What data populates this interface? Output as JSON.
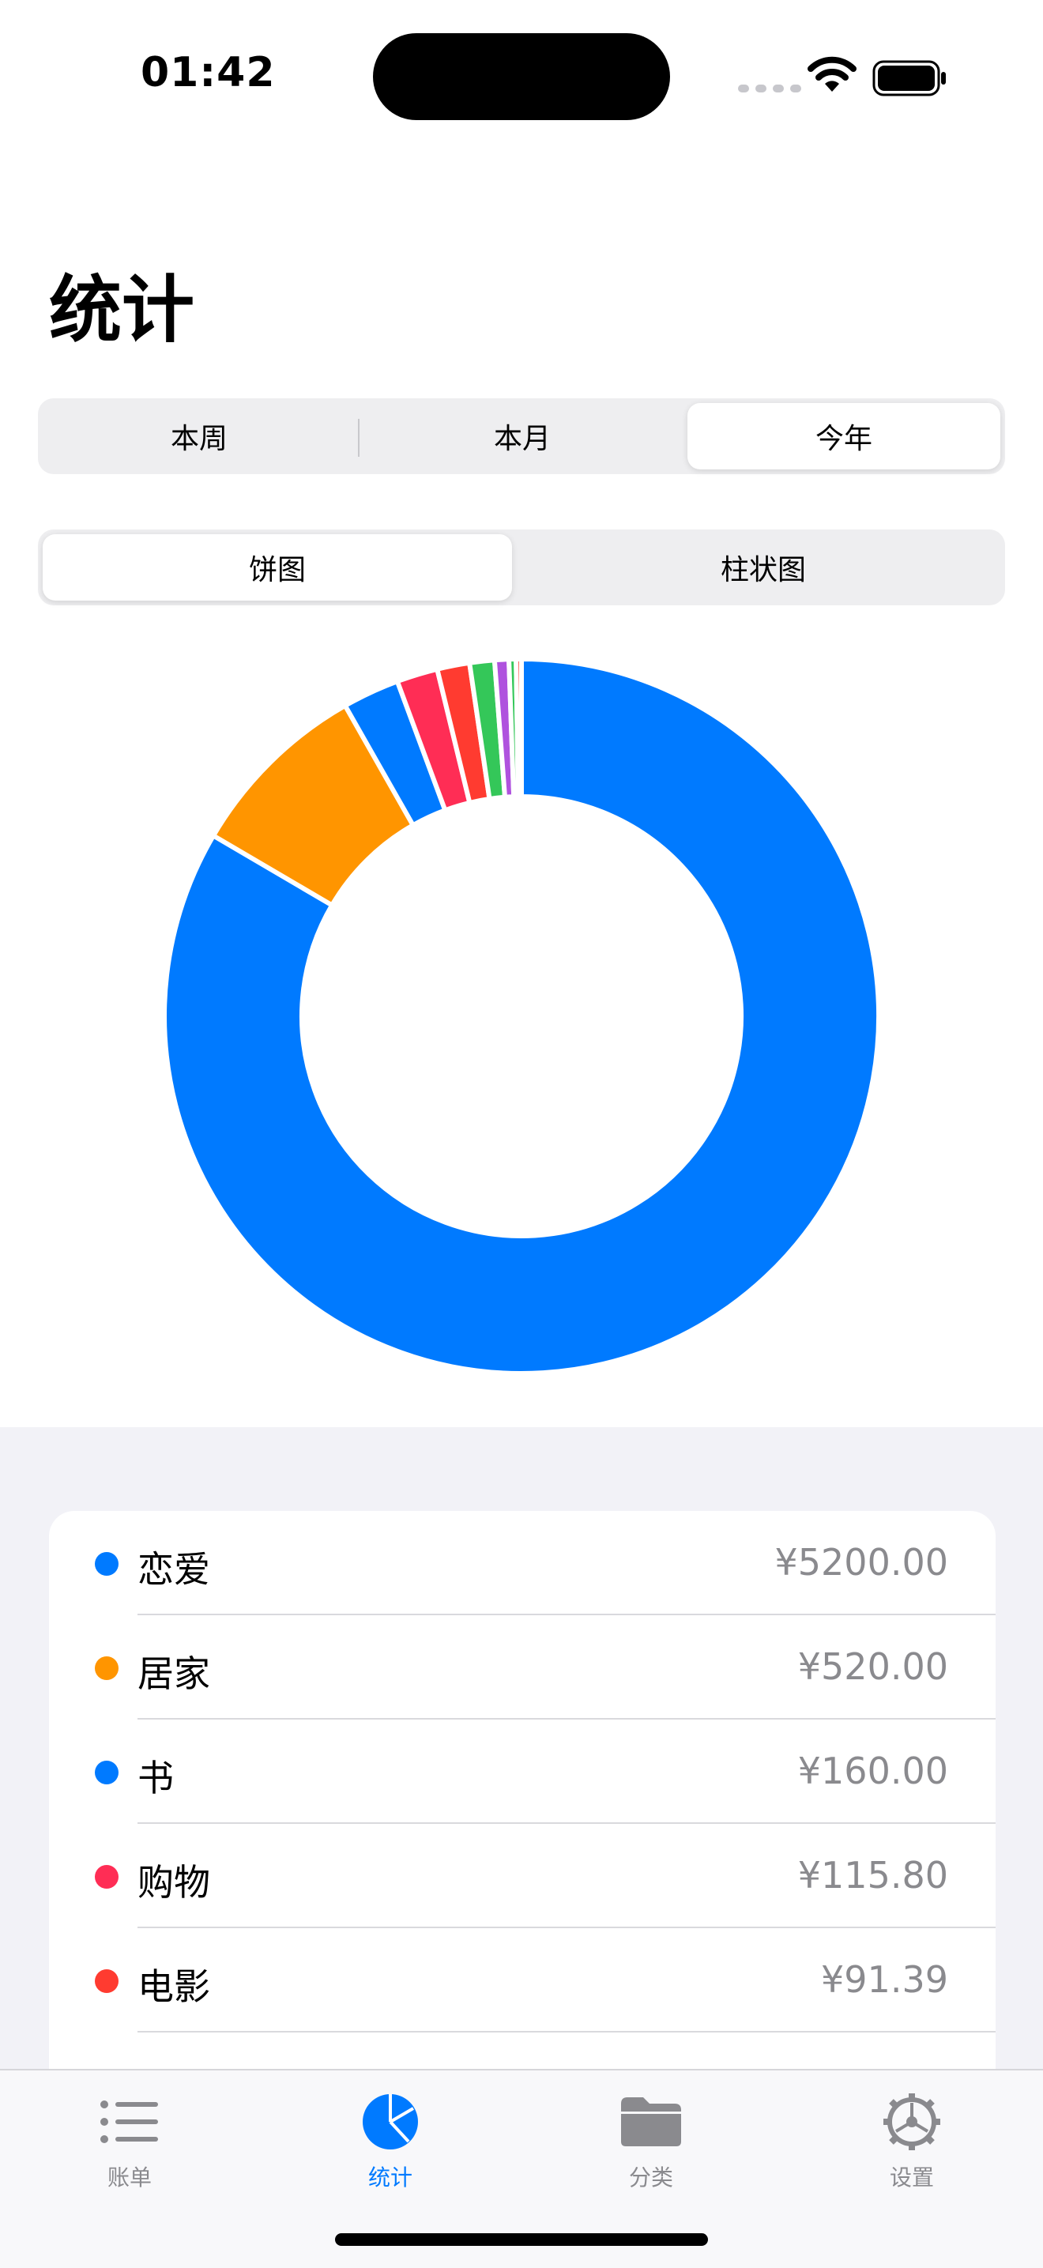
{
  "status_bar": {
    "time": "01:42"
  },
  "page": {
    "title": "统计"
  },
  "period_control": {
    "options": [
      "本周",
      "本月",
      "今年"
    ],
    "selected": "今年"
  },
  "chart_control": {
    "options": [
      "饼图",
      "柱状图"
    ],
    "selected": "饼图"
  },
  "chart_data": {
    "type": "pie",
    "donut": true,
    "slices": [
      {
        "label": "恋爱",
        "value": 5200.0,
        "color": "#007AFF"
      },
      {
        "label": "居家",
        "value": 520.0,
        "color": "#FF9500"
      },
      {
        "label": "书",
        "value": 160.0,
        "color": "#007AFF"
      },
      {
        "label": "购物",
        "value": 115.8,
        "color": "#FF2D55"
      },
      {
        "label": "电影",
        "value": 91.39,
        "color": "#FF3B30"
      },
      {
        "label": "",
        "value": 70,
        "color": "#34C759"
      },
      {
        "label": "",
        "value": 40,
        "color": "#AF52DE"
      },
      {
        "label": "",
        "value": 20,
        "color": "#34C759"
      },
      {
        "label": "",
        "value": 15,
        "color": "#FF3B30"
      }
    ]
  },
  "category_list": [
    {
      "name": "恋爱",
      "amount": "¥5200.00",
      "color": "#007AFF"
    },
    {
      "name": "居家",
      "amount": "¥520.00",
      "color": "#FF9500"
    },
    {
      "name": "书",
      "amount": "¥160.00",
      "color": "#007AFF"
    },
    {
      "name": "购物",
      "amount": "¥115.80",
      "color": "#FF2D55"
    },
    {
      "name": "电影",
      "amount": "¥91.39",
      "color": "#FF3B30"
    }
  ],
  "tab_bar": {
    "items": [
      {
        "label": "账单",
        "icon": "list-icon",
        "active": false
      },
      {
        "label": "统计",
        "icon": "pie-chart-icon",
        "active": true
      },
      {
        "label": "分类",
        "icon": "folder-icon",
        "active": false
      },
      {
        "label": "设置",
        "icon": "gear-icon",
        "active": false
      }
    ]
  }
}
